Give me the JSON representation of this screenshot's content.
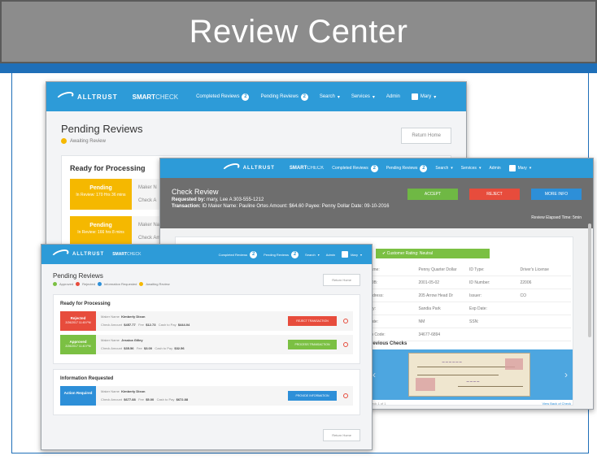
{
  "slide": {
    "title": "Review Center"
  },
  "nav": {
    "logo_text": "ALLTRUST",
    "brand_bold": "SMART",
    "brand_light": "CHECK",
    "completed_reviews": "Completed Reviews",
    "completed_count": "2",
    "pending_reviews": "Pending Reviews",
    "pending_count": "2",
    "search": "Search",
    "services": "Services",
    "admin": "Admin",
    "user": "Mary"
  },
  "window1": {
    "page_title": "Pending Reviews",
    "legend_awaiting": "Awaiting Review",
    "return_label": "Return Home",
    "panel_title": "Ready for Processing",
    "rows": [
      {
        "status": "Pending",
        "sub": "In Review: 170 Hrs 36 mins",
        "f1": "Maker N",
        "f2": "Check A"
      },
      {
        "status": "Pending",
        "sub": "In Review: 166 hrs 8 mins",
        "f1": "Maker Na",
        "f2": "Check Am"
      }
    ]
  },
  "window2": {
    "title": "Check Review",
    "requested_by_label": "Requested by:",
    "requested_by": "mary, Lee A 303-555-1212",
    "transaction_label": "Transaction:",
    "transaction": "ID Maker Name: Pauline Ortes  Amount: $64.60  Payee: Penny Dollar  Date: 09-10-2016",
    "accept": "ACCEPT",
    "reject": "REJECT",
    "more_info": "MORE INFO",
    "elapsed": "Review Elapsed Time: 5min",
    "customer_badge": "Customer Rating: Neutral",
    "info": [
      [
        "Name:",
        "Penny Quarter Dollar",
        "ID Type:",
        "Driver's License"
      ],
      [
        "DOB:",
        "2001-05-02",
        "ID Number:",
        "22006"
      ],
      [
        "Address:",
        "205 Arrow Head Dr",
        "Issuer:",
        "CO"
      ],
      [
        "City:",
        "Sandia Park",
        "Exp Date:",
        ""
      ],
      [
        "State:",
        "NM",
        "SSN:",
        ""
      ],
      [
        "Zip Code:",
        "34677-6894",
        "",
        ""
      ]
    ],
    "previous_checks": "Previous Checks",
    "check_count": "Check 1 of 1",
    "view_back": "View Back of Check",
    "colors": {
      "accept": "#6fb844",
      "reject": "#e74c3c",
      "more_info": "#2d8fd8"
    }
  },
  "window3": {
    "page_title": "Pending Reviews",
    "legend": [
      "Approved",
      "Rejected",
      "Information Requested",
      "Awaiting Review"
    ],
    "legend_colors": [
      "#7bc043",
      "#e74c3c",
      "#2d8fd8",
      "#f5b800"
    ],
    "return_label": "Return Home",
    "panel1_title": "Ready for Processing",
    "rows": [
      {
        "status": "Rejected",
        "sub": "2/26/2017 11:45 PM",
        "color": "#e74c3c",
        "maker_label": "Maker Name",
        "maker": "Kimberly Dixon",
        "check_label": "Check Amount",
        "check": "$457.77",
        "fee_label": "Fee",
        "fee": "$12.73",
        "cash_label": "Cash to Pay",
        "cash": "$444.04",
        "action": "REJECT TRANSACTION",
        "action_color": "#e74c3c"
      },
      {
        "status": "Approved",
        "sub": "2/26/2017 11:40 PM",
        "color": "#7bc043",
        "maker_label": "Maker Name",
        "maker": "Jessica Gilley",
        "check_label": "Check Amount",
        "check": "$35.56",
        "fee_label": "Fee",
        "fee": "$3.00",
        "cash_label": "Cash to Pay",
        "cash": "$32.56",
        "action": "PROCESS TRANSACTION",
        "action_color": "#7bc043"
      }
    ],
    "panel2_title": "Information Requested",
    "info_row": {
      "status": "Action Required",
      "color": "#2d8fd8",
      "maker_label": "Maker Name",
      "maker": "Kimberly Dixon",
      "check_label": "Check Amount",
      "check": "$677.88",
      "fee_label": "Fee",
      "fee": "$5.00",
      "cash_label": "Cash to Pay",
      "cash": "$672.88",
      "action": "PROVIDE INFORMATION",
      "action_color": "#2d8fd8"
    }
  }
}
